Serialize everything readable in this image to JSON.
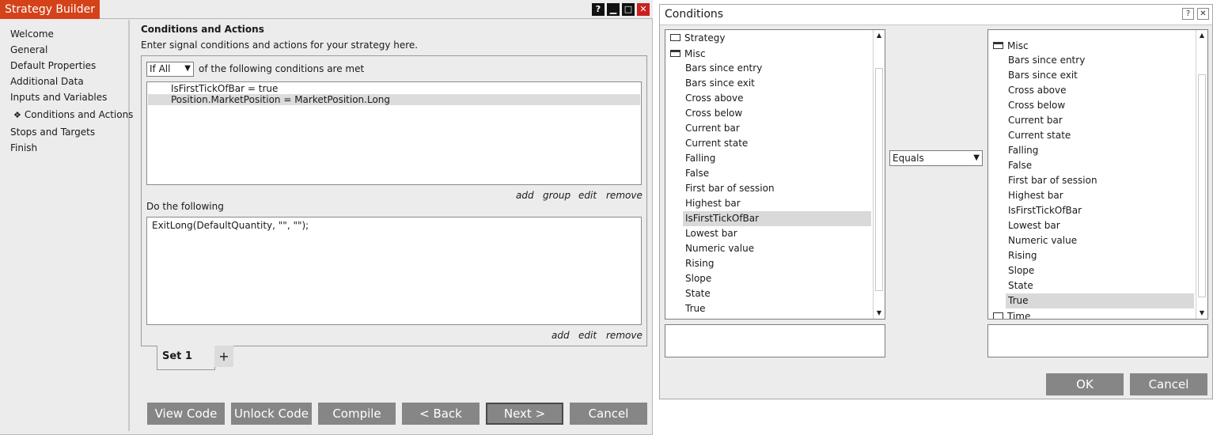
{
  "strategy_builder": {
    "title": "Strategy Builder",
    "window_buttons": {
      "help": "?",
      "minimize": "▁",
      "maximize": "□",
      "close": "✕"
    },
    "nav": [
      {
        "label": "Welcome"
      },
      {
        "label": "General"
      },
      {
        "label": "Default Properties"
      },
      {
        "label": "Additional Data"
      },
      {
        "label": "Inputs and Variables"
      },
      {
        "label": "Conditions and Actions",
        "active": true,
        "bullet": "❖"
      },
      {
        "label": "Stops and Targets"
      },
      {
        "label": "Finish"
      }
    ],
    "section_title": "Conditions and Actions",
    "section_description": "Enter signal conditions and actions for your strategy here.",
    "match_select": {
      "value": "If All"
    },
    "match_label": "of the following conditions are met",
    "conditions": [
      {
        "text": "IsFirstTickOfBar = true",
        "selected": false
      },
      {
        "text": "Position.MarketPosition = MarketPosition.Long",
        "selected": true
      }
    ],
    "condition_links": {
      "add": "add",
      "group": "group",
      "edit": "edit",
      "remove": "remove"
    },
    "do_label": "Do the following",
    "action_text": "ExitLong(DefaultQuantity, \"\", \"\");",
    "action_links": {
      "add": "add",
      "edit": "edit",
      "remove": "remove"
    },
    "tab": {
      "label": "Set 1",
      "add": "+"
    },
    "buttons": {
      "view_code": "View Code",
      "unlock_code": "Unlock Code",
      "compile": "Compile",
      "back": "< Back",
      "next": "Next >",
      "cancel": "Cancel"
    }
  },
  "conditions_dialog": {
    "title": "Conditions",
    "window_buttons": {
      "help": "?",
      "close": "✕"
    },
    "left_tree": {
      "top_items": [
        {
          "label": "Strategy",
          "icon": "folder-closed-icon"
        },
        {
          "label": "Misc",
          "icon": "folder-open-icon"
        }
      ],
      "items": [
        "Bars since entry",
        "Bars since exit",
        "Cross above",
        "Cross below",
        "Current bar",
        "Current state",
        "Falling",
        "False",
        "First bar of session",
        "Highest bar",
        "IsFirstTickOfBar",
        "Lowest bar",
        "Numeric value",
        "Rising",
        "Slope",
        "State",
        "True"
      ],
      "selected": "IsFirstTickOfBar"
    },
    "operator_select": {
      "value": "Equals"
    },
    "right_tree": {
      "folder": {
        "label": "Misc",
        "icon": "folder-open-icon"
      },
      "items": [
        "Bars since entry",
        "Bars since exit",
        "Cross above",
        "Cross below",
        "Current bar",
        "Current state",
        "Falling",
        "False",
        "First bar of session",
        "Highest bar",
        "IsFirstTickOfBar",
        "Lowest bar",
        "Numeric value",
        "Rising",
        "Slope",
        "State",
        "True"
      ],
      "selected": "True",
      "next_folder": {
        "label": "Time",
        "icon": "folder-closed-icon"
      }
    },
    "buttons": {
      "ok": "OK",
      "cancel": "Cancel"
    }
  }
}
